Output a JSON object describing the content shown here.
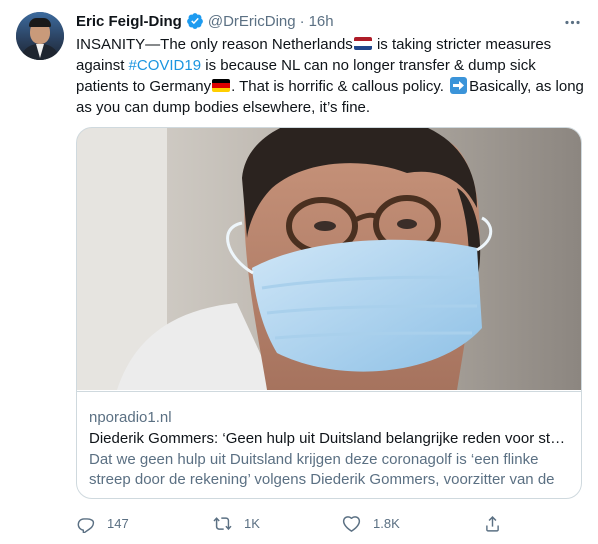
{
  "tweet": {
    "author_name": "Eric Feigl-Ding",
    "handle": "@DrEricDing",
    "separator": "·",
    "time": "16h",
    "text_parts": {
      "p1": "INSANITY—The only reason Netherlands",
      "p2": " is taking stricter measures against ",
      "hashtag": "#COVID19",
      "p3": " is because NL can no longer transfer & dump sick patients to Germany",
      "p4": ". That is horrific & callous policy. ",
      "p5": "Basically, as long as you can dump bodies elsewhere, it’s fine."
    }
  },
  "link_card": {
    "domain": "nporadio1.nl",
    "title": "Diederik Gommers: ‘Geen hulp uit Duitsland belangrijke reden voor ste…",
    "description": "Dat we geen hulp uit Duitsland krijgen deze coronagolf is ‘een flinke streep door de rekening’ volgens Diederik Gommers, voorzitter van de …"
  },
  "actions": {
    "replies": "147",
    "retweets": "1K",
    "likes": "1.8K"
  },
  "colors": {
    "accent": "#1b95e0",
    "secondary_text": "#5b7083",
    "border": "#cfd9de"
  },
  "icons": [
    "verified-badge-icon",
    "more-options-icon",
    "netherlands-flag-icon",
    "germany-flag-icon",
    "right-arrow-emoji-icon",
    "reply-icon",
    "retweet-icon",
    "like-icon",
    "share-icon"
  ]
}
